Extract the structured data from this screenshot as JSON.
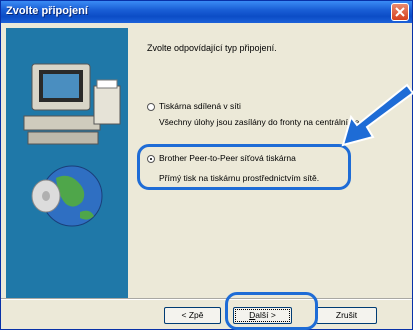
{
  "window": {
    "title": "Zvolte připojení"
  },
  "prompt": "Zvolte odpovídající typ připojení.",
  "options": [
    {
      "label": "Tiskárna sdílená v síti",
      "description": "Všechny úlohy jsou zasílány do fronty na centrální se",
      "selected": false
    },
    {
      "label": "Brother Peer-to-Peer síťová tiskárna",
      "description": "Přímý tisk na tiskárnu prostřednictvím sítě.",
      "selected": true
    }
  ],
  "buttons": {
    "back": "< Zpě",
    "next_accel": "D",
    "next_rest": "alší >",
    "cancel": "Zrušit"
  },
  "colors": {
    "title_bar": "#0b4cc6",
    "highlight": "#1e6cd6",
    "arrow": "#1e6cd6",
    "side_panel": "#1f78a8"
  }
}
